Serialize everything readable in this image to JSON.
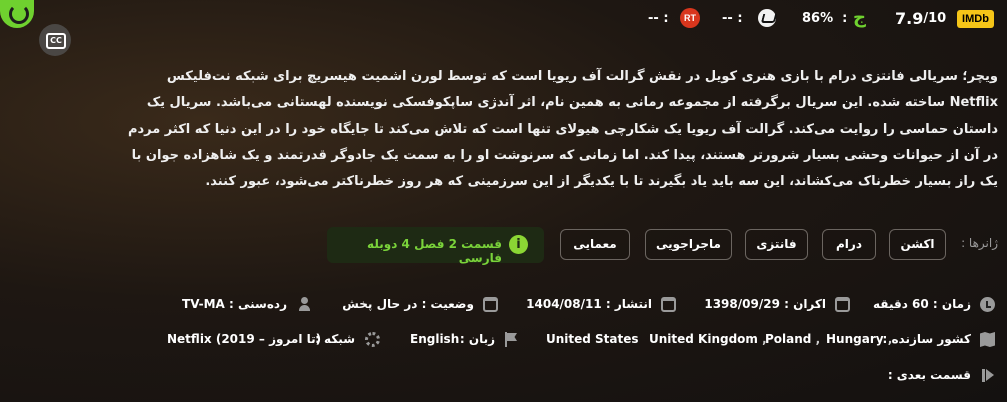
{
  "ratings": {
    "imdb_badge": "IMDb",
    "imdb_score": "7.9",
    "imdb_max": "/10",
    "zoomg_value": "86%",
    "zoomg_icon": "zoomg-logo-icon",
    "metacritic_value": "-- :",
    "rottentomatoes_badge": "RT",
    "rottentomatoes_value": "-- :"
  },
  "buttons": {
    "cc_label": "CC"
  },
  "description": "ویچر؛ سریالی فانتزی درام با بازی هنری کویل در نقش گرالت آف ریویا است که توسط لورن اشمیت هیسریچ برای شبکه نت‌فلیکس Netflix ساخته شده. این سریال برگرفته از مجموعه رمانی به همین نام، اثر آندژی ساپکوفسکی نویسنده لهستانی می‌باشد. سریال یک داستان حماسی را روایت می‌کند. گرالت آف ریویا یک شکارچی هیولای تنها است که تلاش می‌کند تا جایگاه خود را در این دنیا که اکثر مردم در آن از حیوانات وحشی بسیار شرورتر هستند، پیدا کند. اما زمانی که سرنوشت او را به سمت یک جادوگر قدرتمند و یک شاهزاده جوان با یک راز بسیار خطرناک می‌کشاند، این سه باید یاد بگیرند تا با یکدیگر از این سرزمینی که هر روز خطرناکتر می‌شود، عبور کنند.",
  "genres": {
    "label": "ژانرها :",
    "items": [
      "اکشن",
      "درام",
      "فانتزی",
      "ماجراجویی",
      "معمایی"
    ]
  },
  "dub_banner": {
    "text": "قسمت 2 فصل 4 دوبله فارسی",
    "icon": "i"
  },
  "details": {
    "duration": "زمان : 60 دقیقه",
    "release": "اکران : 1398/09/29",
    "published": "انتشار : 1404/08/11",
    "status": "وضعیت : در حال پخش",
    "age_rating": "رده‌سنی : TV-MA",
    "countries_label": "کشور سازنده :",
    "countries": [
      "Hungary",
      "Poland",
      "United Kingdom",
      "United States"
    ],
    "language_label": "زبان :",
    "language": "English",
    "network_label": "شبکه :",
    "network": "Netflix (2019 – تا امروز)",
    "next_episode": "قسمت بعدی :"
  }
}
